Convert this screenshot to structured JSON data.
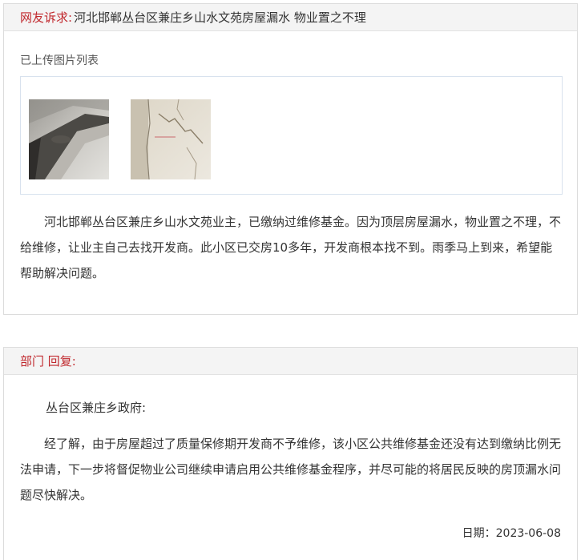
{
  "complaint": {
    "label": "网友诉求:",
    "title": "河北邯郸丛台区兼庄乡山水文苑房屋漏水 物业置之不理",
    "images_label": "已上传图片列表",
    "images": [
      {
        "icon": "photo-ceiling-leak"
      },
      {
        "icon": "photo-wall-crack"
      }
    ],
    "body": "河北邯郸丛台区兼庄乡山水文苑业主，已缴纳过维修基金。因为顶层房屋漏水，物业置之不理，不给维修，让业主自己去找开发商。此小区已交房10多年，开发商根本找不到。雨季马上到来，希望能帮助解决问题。"
  },
  "reply": {
    "label": "部门 回复:",
    "salutation": "丛台区兼庄乡政府:",
    "body": "经了解，由于房屋超过了质量保修期开发商不予维修，该小区公共维修基金还没有达到缴纳比例无法申请，下一步将督促物业公司继续申请启用公共维修基金程序，并尽可能的将居民反映的房顶漏水问题尽快解决。",
    "date": "日期：2023-06-08"
  }
}
